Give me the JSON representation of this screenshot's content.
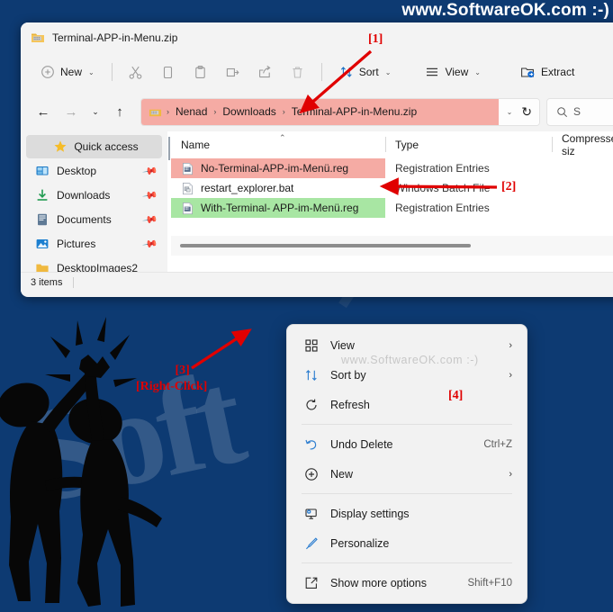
{
  "banner": {
    "watermark": "www.SoftwareOK.com  :-)"
  },
  "background": {
    "watermark_text": "Soft",
    "color": "#0d3a72"
  },
  "window": {
    "title": "Terminal-APP-in-Menu.zip",
    "title_icon": "zip-folder-icon"
  },
  "toolbar": {
    "new_label": "New",
    "cut_label": "Cut",
    "copy_label": "Copy",
    "paste_label": "Paste",
    "rename_label": "Rename",
    "share_label": "Share",
    "delete_label": "Delete",
    "sort_label": "Sort",
    "view_label": "View",
    "extract_label": "Extract",
    "chevron": "⌄"
  },
  "addressbar": {
    "back": "←",
    "forward": "→",
    "recent": "⌄",
    "up": "↑",
    "refresh": "↻",
    "dropdown": "⌄",
    "highlight_color": "#f5aba4",
    "crumbs": [
      {
        "label": "Nenad"
      },
      {
        "label": "Downloads"
      },
      {
        "label": "Terminal-APP-in-Menu.zip"
      }
    ],
    "separator": "›",
    "search_text": "S"
  },
  "sidebar": {
    "items": [
      {
        "label": "Quick access",
        "icon": "star-icon",
        "selected": true,
        "pinned": false
      },
      {
        "label": "Desktop",
        "icon": "desktop-icon",
        "selected": false,
        "pinned": true
      },
      {
        "label": "Downloads",
        "icon": "download-icon",
        "selected": false,
        "pinned": true
      },
      {
        "label": "Documents",
        "icon": "documents-icon",
        "selected": false,
        "pinned": true
      },
      {
        "label": "Pictures",
        "icon": "pictures-icon",
        "selected": false,
        "pinned": true
      },
      {
        "label": "DesktopImages2",
        "icon": "folder-icon",
        "selected": false,
        "pinned": false
      }
    ],
    "pin_glyph": "📌"
  },
  "filelist": {
    "columns": [
      {
        "label": "Name",
        "sorted": true,
        "sort_glyph": "⌃"
      },
      {
        "label": "Type"
      },
      {
        "label": "Compressed siz"
      }
    ],
    "rows": [
      {
        "name": "No-Terminal-APP-im-Menü.reg",
        "type": "Registration Entries",
        "icon": "reg-file-icon",
        "highlight": "red"
      },
      {
        "name": "restart_explorer.bat",
        "type": "Windows Batch File",
        "icon": "bat-file-icon",
        "highlight": "none"
      },
      {
        "name": "With-Terminal- APP-im-Menü.reg",
        "type": "Registration Entries",
        "icon": "reg-file-icon",
        "highlight": "green"
      }
    ],
    "highlight_red": "#f5aba4",
    "highlight_green": "#a8e6a3"
  },
  "statusbar": {
    "item_count": "3 items"
  },
  "contextmenu": {
    "watermark": "www.SoftwareOK.com  :-)",
    "items": [
      {
        "label": "View",
        "icon": "grid-view-icon",
        "accel": "",
        "submenu": true
      },
      {
        "label": "Sort by",
        "icon": "sort-icon",
        "accel": "",
        "submenu": true
      },
      {
        "label": "Refresh",
        "icon": "refresh-icon",
        "accel": "",
        "submenu": false
      },
      {
        "separator": true
      },
      {
        "label": "Undo Delete",
        "icon": "undo-icon",
        "accel": "Ctrl+Z",
        "submenu": false
      },
      {
        "label": "New",
        "icon": "plus-circle-icon",
        "accel": "",
        "submenu": true
      },
      {
        "separator": true
      },
      {
        "label": "Display settings",
        "icon": "display-settings-icon",
        "accel": "",
        "submenu": false
      },
      {
        "label": "Personalize",
        "icon": "personalize-brush-icon",
        "accel": "",
        "submenu": false
      },
      {
        "separator": true
      },
      {
        "label": "Show more options",
        "icon": "show-more-options-icon",
        "accel": "Shift+F10",
        "submenu": false
      }
    ],
    "submenu_arrow": "›"
  },
  "annotations": {
    "one": "[1]",
    "two": "[2]",
    "three": "[3]",
    "three_sub": "[Right-Click]",
    "four": "[4]",
    "color": "#e00000"
  }
}
